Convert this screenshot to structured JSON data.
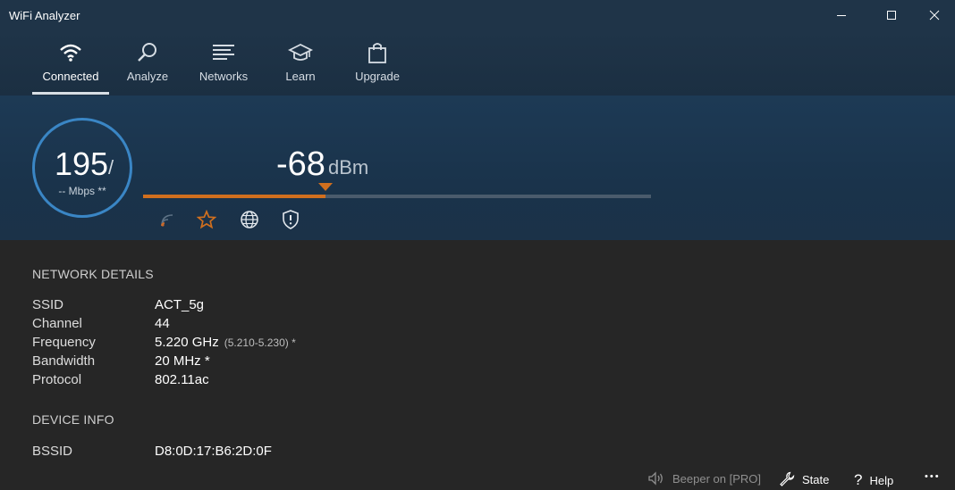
{
  "window": {
    "title": "WiFi Analyzer",
    "controls": {
      "minimize": "minimize-icon",
      "maximize": "maximize-icon",
      "close": "close-icon"
    }
  },
  "nav": {
    "items": [
      {
        "label": "Connected",
        "icon": "wifi-icon",
        "active": true
      },
      {
        "label": "Analyze",
        "icon": "magnifier-icon",
        "active": false
      },
      {
        "label": "Networks",
        "icon": "list-icon",
        "active": false
      },
      {
        "label": "Learn",
        "icon": "graduation-cap-icon",
        "active": false
      },
      {
        "label": "Upgrade",
        "icon": "shopping-bag-icon",
        "active": false
      }
    ]
  },
  "signal": {
    "speed_value": "195",
    "speed_slash": "/",
    "speed_unit": "-- Mbps **",
    "dbm_value": "-68",
    "dbm_unit": "dBm",
    "strength_fraction": 0.36,
    "accent_color": "#d06f1e",
    "ring_color": "#3a86c5",
    "status_icons": [
      "signal-strength-icon",
      "favorite-star-icon",
      "internet-globe-icon",
      "security-shield-icon"
    ]
  },
  "network_details": {
    "heading": "NETWORK DETAILS",
    "rows": [
      {
        "label": "SSID",
        "value": "ACT_5g",
        "sub": ""
      },
      {
        "label": "Channel",
        "value": "44",
        "sub": ""
      },
      {
        "label": "Frequency",
        "value": "5.220 GHz",
        "sub": "(5.210-5.230) *"
      },
      {
        "label": "Bandwidth",
        "value": "20 MHz *",
        "sub": ""
      },
      {
        "label": "Protocol",
        "value": "802.11ac",
        "sub": ""
      }
    ]
  },
  "device_info": {
    "heading": "DEVICE INFO",
    "rows": [
      {
        "label": "BSSID",
        "value": "D8:0D:17:B6:2D:0F"
      }
    ]
  },
  "bottom_bar": {
    "beeper_label": "Beeper on [PRO]",
    "state_label": "State",
    "help_label": "Help",
    "more_label": "•••"
  }
}
